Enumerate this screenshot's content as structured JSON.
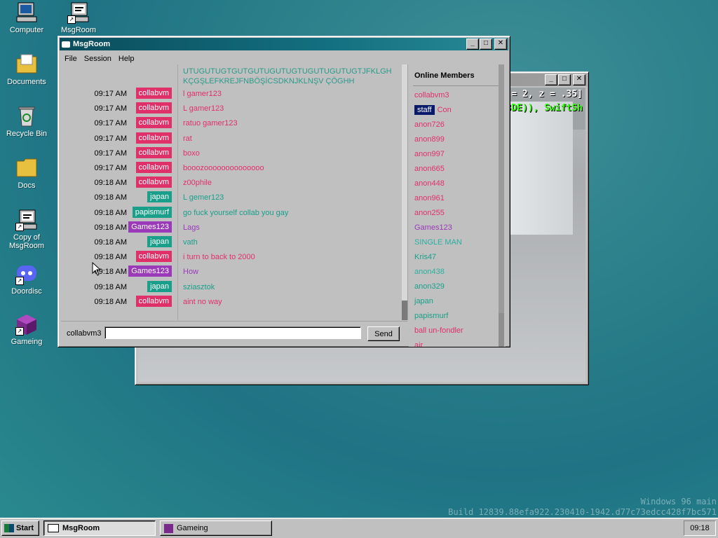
{
  "desktop": {
    "icons": [
      {
        "label": "Computer",
        "icon": "computer-icon"
      },
      {
        "label": "MsgRoom",
        "icon": "msgroom-icon"
      },
      {
        "label": "Documents",
        "icon": "documents-folder-icon"
      },
      {
        "label": "Recycle Bin",
        "icon": "recycle-bin-icon"
      },
      {
        "label": "Docs",
        "icon": "folder-icon"
      },
      {
        "label": "Copy of MsgRoom",
        "icon": "msgroom-icon"
      },
      {
        "label": "Doordisc",
        "icon": "discord-icon"
      },
      {
        "label": "Gameing",
        "icon": "cube-icon"
      }
    ],
    "watermark": [
      "Windows 96 main",
      "Build 12839.88efa922.230410-1942.d77c73edcc428f7bc571"
    ]
  },
  "game_window": {
    "code_line1": "= 2, z = .35]",
    "code_line2": "3DE)), SwiftSh"
  },
  "msgroom": {
    "title": "MsgRoom",
    "menu": [
      "File",
      "Session",
      "Help"
    ],
    "top_text": [
      "UTUGUTUGTGUTGUTUGUTUGTUGUTUGUTUGTJFKLGH",
      "KÇGŞLEFKREJFNBÖŞİCSDKNJKLNŞV ÇÖGHH"
    ],
    "messages": [
      {
        "time": "09:17 AM",
        "user": "collabvm",
        "color": "#e0306a",
        "text": "l gamer123"
      },
      {
        "time": "09:17 AM",
        "user": "collabvm",
        "color": "#e0306a",
        "text": "L gamer123"
      },
      {
        "time": "09:17 AM",
        "user": "collabvm",
        "color": "#e0306a",
        "text": "ratuo gamer123"
      },
      {
        "time": "09:17 AM",
        "user": "collabvm",
        "color": "#e0306a",
        "text": "rat"
      },
      {
        "time": "09:17 AM",
        "user": "collabvm",
        "color": "#e0306a",
        "text": "boxo"
      },
      {
        "time": "09:17 AM",
        "user": "collabvm",
        "color": "#e0306a",
        "text": "booozoooooooooooooo"
      },
      {
        "time": "09:18 AM",
        "user": "collabvm",
        "color": "#e0306a",
        "text": "z00phile"
      },
      {
        "time": "09:18 AM",
        "user": "japan",
        "color": "#1aa08a",
        "text": "L gemer123"
      },
      {
        "time": "09:18 AM",
        "user": "papismurf",
        "color": "#1aa08a",
        "text": "go fuck yourself collab you gay"
      },
      {
        "time": "09:18 AM",
        "user": "Games123",
        "color": "#9a3ab8",
        "text": "Lags"
      },
      {
        "time": "09:18 AM",
        "user": "japan",
        "color": "#1aa08a",
        "text": "vath"
      },
      {
        "time": "09:18 AM",
        "user": "collabvm",
        "color": "#e0306a",
        "text": "i turn to back to 2000"
      },
      {
        "time": "09:18 AM",
        "user": "Games123",
        "color": "#9a3ab8",
        "text": "How"
      },
      {
        "time": "09:18 AM",
        "user": "japan",
        "color": "#1aa08a",
        "text": "sziasztok"
      },
      {
        "time": "09:18 AM",
        "user": "collabvm",
        "color": "#e0306a",
        "text": "aint no way"
      }
    ],
    "members_title": "Online Members",
    "members": [
      {
        "name": "collabvm3",
        "color": "#e0306a"
      },
      {
        "name": "Con",
        "color": "#e0306a",
        "badge": "staff"
      },
      {
        "name": "anon726",
        "color": "#e0306a"
      },
      {
        "name": "anon899",
        "color": "#e0306a"
      },
      {
        "name": "anon997",
        "color": "#e0306a"
      },
      {
        "name": "anon665",
        "color": "#e0306a"
      },
      {
        "name": "anon448",
        "color": "#e0306a"
      },
      {
        "name": "anon961",
        "color": "#e0306a"
      },
      {
        "name": "anon255",
        "color": "#e0306a"
      },
      {
        "name": "Games123",
        "color": "#9a3ab8"
      },
      {
        "name": "SINGLE MAN",
        "color": "#2ab0a0"
      },
      {
        "name": "Kris47",
        "color": "#1aa08a"
      },
      {
        "name": "anon438",
        "color": "#2ab0a0"
      },
      {
        "name": "anon329",
        "color": "#1aa08a"
      },
      {
        "name": "japan",
        "color": "#1aa08a"
      },
      {
        "name": "papismurf",
        "color": "#1aa08a"
      },
      {
        "name": "ball un-fondler",
        "color": "#e0306a"
      },
      {
        "name": "air",
        "color": "#e0306a"
      }
    ],
    "input": {
      "username": "collabvm3",
      "value": "",
      "send_label": "Send"
    }
  },
  "taskbar": {
    "start_label": "Start",
    "tasks": [
      {
        "label": "MsgRoom",
        "icon": "msgroom-icon",
        "active": true
      },
      {
        "label": "Gameing",
        "icon": "cube-icon",
        "active": false
      }
    ],
    "clock": "09:18"
  }
}
